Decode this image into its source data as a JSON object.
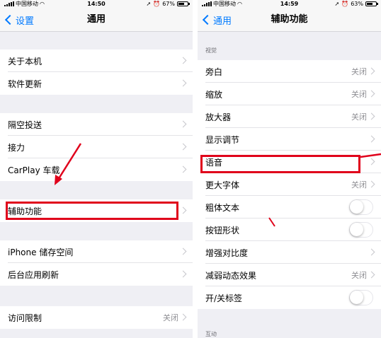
{
  "left": {
    "status": {
      "carrier": "中国移动",
      "time": "14:50",
      "battery": "67%",
      "battery_level": 0.67
    },
    "nav": {
      "back": "设置",
      "title": "通用"
    },
    "rows": [
      {
        "label": "关于本机"
      },
      {
        "label": "软件更新"
      },
      {
        "label": "隔空投送"
      },
      {
        "label": "接力"
      },
      {
        "label": "CarPlay 车载"
      },
      {
        "label": "辅助功能"
      },
      {
        "label": "iPhone 储存空间"
      },
      {
        "label": "后台应用刷新"
      },
      {
        "label": "访问限制",
        "value": "关闭"
      }
    ]
  },
  "right": {
    "status": {
      "carrier": "中国移动",
      "time": "14:59",
      "battery": "63%",
      "battery_level": 0.63
    },
    "nav": {
      "back": "通用",
      "title": "辅助功能"
    },
    "section_vision": "视觉",
    "section_bottom": "互动",
    "rows": [
      {
        "label": "旁白",
        "value": "关闭"
      },
      {
        "label": "缩放",
        "value": "关闭"
      },
      {
        "label": "放大器",
        "value": "关闭"
      },
      {
        "label": "显示调节"
      },
      {
        "label": "语音"
      },
      {
        "label": "更大字体",
        "value": "关闭"
      },
      {
        "label": "粗体文本",
        "toggle": "off"
      },
      {
        "label": "按钮形状",
        "toggle": "off"
      },
      {
        "label": "增强对比度"
      },
      {
        "label": "减弱动态效果",
        "value": "关闭"
      },
      {
        "label": "开/关标签",
        "toggle": "off"
      }
    ]
  },
  "colors": {
    "annotation": "#e0001b",
    "ios_blue": "#007aff",
    "background": "#efeff4"
  }
}
